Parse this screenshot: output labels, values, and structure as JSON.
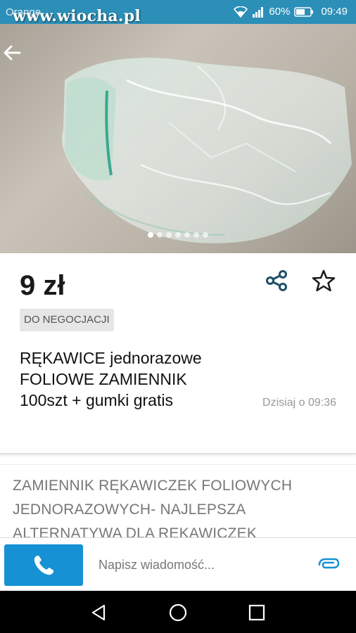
{
  "status_bar": {
    "carrier": "Orange",
    "watermark": "www.wiocha.pl",
    "battery": "60%",
    "time": "09:49"
  },
  "gallery": {
    "image_count": 7,
    "active_index": 0
  },
  "listing": {
    "price": "9 zł",
    "negotiable_badge": "DO NEGOCJACJI",
    "title_lines": [
      "RĘKAWICE jednorazowe",
      "FOLIOWE ZAMIENNIK",
      "100szt + gumki gratis"
    ],
    "date": "Dzisiaj o 09:36"
  },
  "description": {
    "lines": [
      "ZAMIENNIK RĘKAWICZEK FOLIOWYCH",
      "JEDNORAZOWYCH- NAJLEPSZA",
      "ALTERNATYWA DLA RĘKAWICZEK"
    ]
  },
  "bottom_bar": {
    "message_placeholder": "Napisz wiadomość..."
  },
  "icons": {
    "back": "arrow-left-icon",
    "share": "share-icon",
    "favorite": "star-icon",
    "call": "phone-icon",
    "attach": "paperclip-icon"
  },
  "colors": {
    "status_bar": "#2b8fb8",
    "call_button": "#1591d4",
    "share_icon": "#1f4e68",
    "attach_icon": "#1591d4"
  }
}
